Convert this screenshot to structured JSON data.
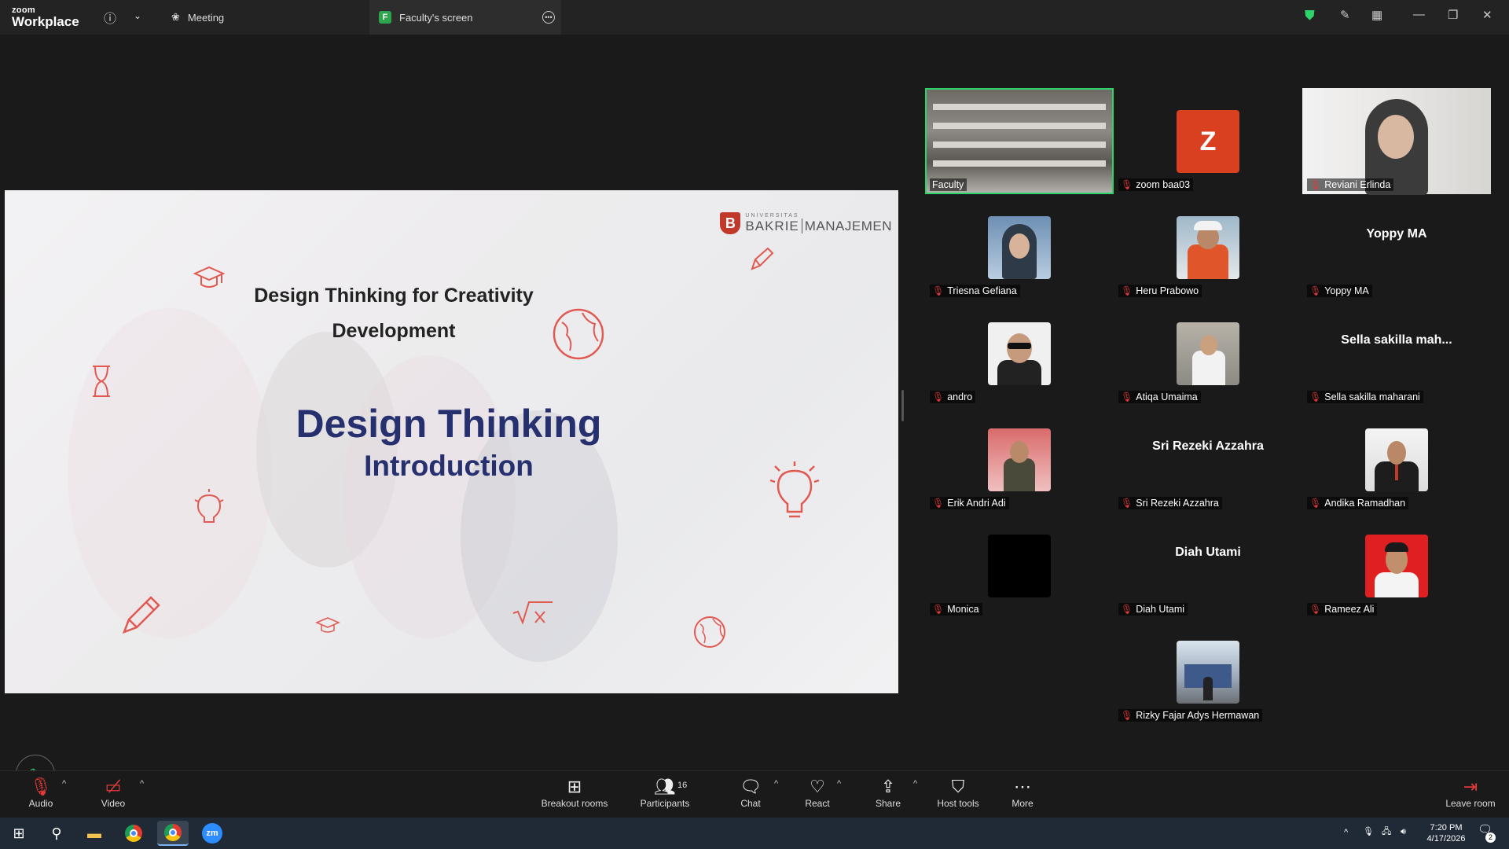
{
  "app": {
    "logo_line1": "zoom",
    "logo_line2": "Workplace"
  },
  "tabs": [
    {
      "label": "Meeting",
      "icon": "meeting-icon"
    },
    {
      "label": "Faculty's screen",
      "favicon_letter": "F"
    }
  ],
  "slide": {
    "brand_small": "UNIVERSITAS",
    "brand_name": "BAKRIE",
    "brand_unit": "MANAJEMEN",
    "brand_letter": "B",
    "title_line1": "Design Thinking for Creativity",
    "title_line2": "Development",
    "heading": "Design Thinking",
    "subheading": "Introduction"
  },
  "participants": [
    {
      "name": "Faculty",
      "type": "video",
      "active": true,
      "muted": false
    },
    {
      "name": "zoom baa03",
      "type": "letter",
      "letter": "Z",
      "muted": true
    },
    {
      "name": "Reviani Erlinda",
      "type": "video",
      "muted": true
    },
    {
      "name": "Triesna Gefiana",
      "type": "avatar",
      "muted": true
    },
    {
      "name": "Heru Prabowo",
      "type": "avatar",
      "muted": true
    },
    {
      "name": "Yoppy MA",
      "type": "text",
      "display": "Yoppy MA",
      "muted": true
    },
    {
      "name": "andro",
      "type": "avatar",
      "muted": true
    },
    {
      "name": "Atiqa Umaima",
      "type": "avatar",
      "muted": true
    },
    {
      "name": "Sella sakilla maharani",
      "type": "text",
      "display": "Sella sakilla mah...",
      "muted": true
    },
    {
      "name": "Erik Andri Adi",
      "type": "avatar",
      "muted": true
    },
    {
      "name": "Sri Rezeki Azzahra",
      "type": "text",
      "display": "Sri Rezeki Azzahra",
      "muted": true
    },
    {
      "name": "Andika Ramadhan",
      "type": "avatar",
      "muted": true
    },
    {
      "name": "Monica",
      "type": "avatar",
      "muted": true
    },
    {
      "name": "Diah Utami",
      "type": "text",
      "display": "Diah Utami",
      "muted": true
    },
    {
      "name": "Rameez Ali",
      "type": "avatar",
      "muted": true
    },
    {
      "name": "Rizky Fajar Adys Hermawan",
      "type": "avatar",
      "muted": true
    }
  ],
  "toolbar": {
    "audio": "Audio",
    "video": "Video",
    "breakout": "Breakout rooms",
    "participants": "Participants",
    "participants_count": "16",
    "chat": "Chat",
    "react": "React",
    "share": "Share",
    "host_tools": "Host tools",
    "more": "More",
    "leave": "Leave room"
  },
  "taskbar": {
    "time": "7:20 PM",
    "date": "4/17/2026",
    "notifications": "2"
  },
  "colors": {
    "accent_green": "#2ed36a",
    "slide_heading": "#27306f",
    "mute_red": "#e03a3a",
    "brand_red": "#c0392b"
  }
}
